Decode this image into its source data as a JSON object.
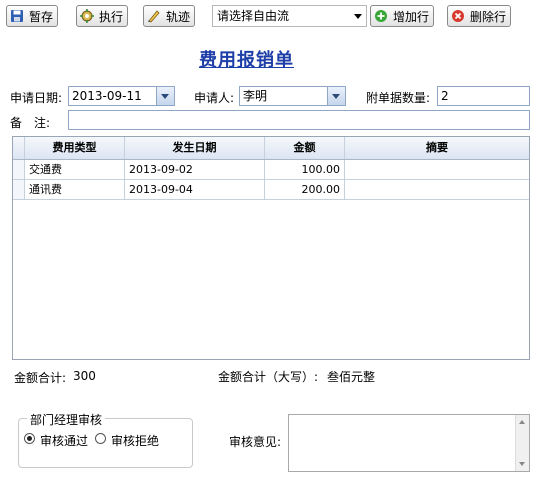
{
  "toolbar": {
    "save_label": "暂存",
    "execute_label": "执行",
    "trace_label": "轨迹",
    "flow_select_value": "请选择自由流",
    "add_row_label": "增加行",
    "delete_row_label": "删除行",
    "icons": {
      "save": "floppy-disk-icon",
      "execute": "gear-icon",
      "trace": "pen-trace-icon",
      "add_row": "plus-circle-icon",
      "delete_row": "delete-circle-icon"
    },
    "colors": {
      "add": "#3aa63a",
      "delete": "#d63a2f"
    }
  },
  "form": {
    "title": "费用报销单",
    "apply_date_label": "申请日期:",
    "apply_date_value": "2013-09-11",
    "applicant_label": "申请人:",
    "applicant_value": "李明",
    "attachments_label": "附单据数量:",
    "attachments_value": "2",
    "remark_label": "备　注:",
    "remark_value": ""
  },
  "grid": {
    "columns": [
      "费用类型",
      "发生日期",
      "金额",
      "摘要"
    ],
    "rows": [
      {
        "type": "交通费",
        "date": "2013-09-02",
        "amount": "100.00",
        "summary": ""
      },
      {
        "type": "通讯费",
        "date": "2013-09-04",
        "amount": "200.00",
        "summary": ""
      }
    ]
  },
  "totals": {
    "total_label": "金额合计:",
    "total_value": "300",
    "total_upper_label": "金额合计（大写）:",
    "total_upper_value": "叁佰元整"
  },
  "approval": {
    "group_title": "部门经理审核",
    "approve_label": "审核通过",
    "reject_label": "审核拒绝",
    "selected": "approve",
    "opinion_label": "审核意见:",
    "opinion_value": ""
  }
}
